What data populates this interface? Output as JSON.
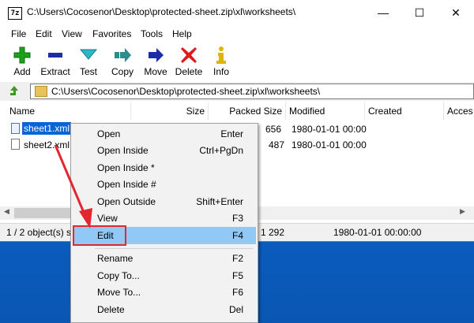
{
  "window": {
    "app_icon_text": "7z",
    "title": "C:\\Users\\Cocosenor\\Desktop\\protected-sheet.zip\\xl\\worksheets\\",
    "minimize": "—",
    "maximize": "☐",
    "close": "✕"
  },
  "menubar": [
    "File",
    "Edit",
    "View",
    "Favorites",
    "Tools",
    "Help"
  ],
  "toolbar": [
    {
      "label": "Add",
      "icon": "plus-icon",
      "color": "#1aa31a"
    },
    {
      "label": "Extract",
      "icon": "minus-icon",
      "color": "#1b2ca6"
    },
    {
      "label": "Test",
      "icon": "chevron-down-icon",
      "color": "#2ab7c9"
    },
    {
      "label": "Copy",
      "icon": "copy-arrow-icon",
      "color": "#2d8c8c"
    },
    {
      "label": "Move",
      "icon": "move-arrow-icon",
      "color": "#1b2ca6"
    },
    {
      "label": "Delete",
      "icon": "delete-x-icon",
      "color": "#e01b1b"
    },
    {
      "label": "Info",
      "icon": "info-icon",
      "color": "#e0b400"
    }
  ],
  "address": {
    "path": "C:\\Users\\Cocosenor\\Desktop\\protected-sheet.zip\\xl\\worksheets\\"
  },
  "columns": [
    "Name",
    "Size",
    "Packed Size",
    "Modified",
    "Created",
    "Acces"
  ],
  "rows": [
    {
      "name": "sheet1.xml",
      "packed": "656",
      "modified": "1980-01-01 00:00",
      "selected": true
    },
    {
      "name": "sheet2.xml",
      "packed": "487",
      "modified": "1980-01-01 00:00",
      "selected": false
    }
  ],
  "status": {
    "selection": "1 / 2 object(s) s",
    "size": "1 292",
    "date": "1980-01-01 00:00:00"
  },
  "context_menu": [
    {
      "label": "Open",
      "shortcut": "Enter"
    },
    {
      "label": "Open Inside",
      "shortcut": "Ctrl+PgDn"
    },
    {
      "label": "Open Inside *",
      "shortcut": ""
    },
    {
      "label": "Open Inside #",
      "shortcut": ""
    },
    {
      "label": "Open Outside",
      "shortcut": "Shift+Enter"
    },
    {
      "label": "View",
      "shortcut": "F3"
    },
    {
      "label": "Edit",
      "shortcut": "F4"
    },
    {
      "label": "Rename",
      "shortcut": "F2"
    },
    {
      "label": "Copy To...",
      "shortcut": "F5"
    },
    {
      "label": "Move To...",
      "shortcut": "F6"
    },
    {
      "label": "Delete",
      "shortcut": "Del"
    }
  ],
  "colors": {
    "selection_blue": "#0a64d6",
    "menu_highlight": "#90c8f6",
    "annotation_red": "#e3262f",
    "desktop_blue": "#1565c8"
  }
}
